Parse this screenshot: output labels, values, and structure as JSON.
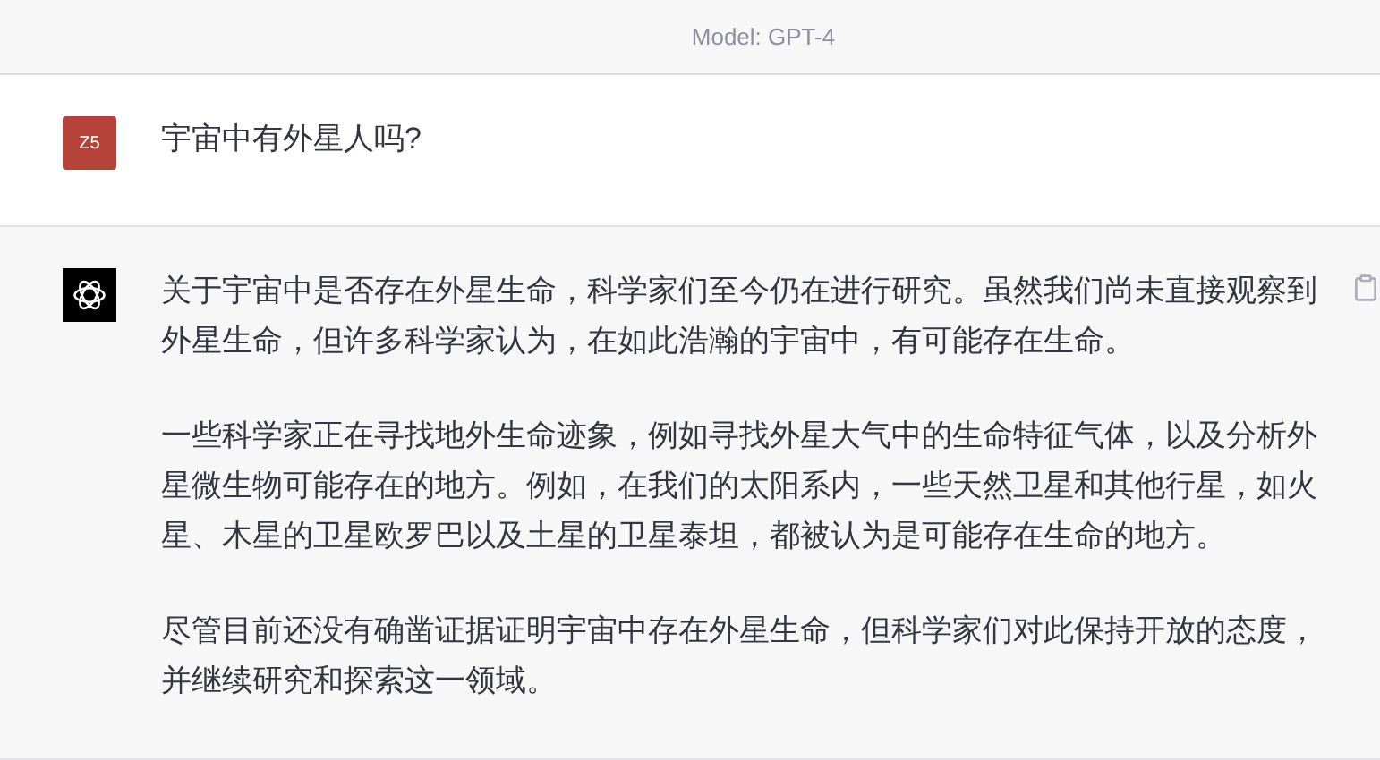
{
  "header": {
    "model": "Model: GPT-4"
  },
  "messages": [
    {
      "kind": "user",
      "avatar": "Z5",
      "paragraphs": [
        "宇宙中有外星人吗?"
      ]
    },
    {
      "kind": "assistant",
      "paragraphs": [
        "关于宇宙中是否存在外星生命，科学家们至今仍在进行研究。虽然我们尚未直接观察到外星生命，但许多科学家认为，在如此浩瀚的宇宙中，有可能存在生命。",
        "一些科学家正在寻找地外生命迹象，例如寻找外星大气中的生命特征气体，以及分析外星微生物可能存在的地方。例如，在我们的太阳系内，一些天然卫星和其他行星，如火星、木星的卫星欧罗巴以及土星的卫星泰坦，都被认为是可能存在生命的地方。",
        "尽管目前还没有确凿证据证明宇宙中存在外星生命，但科学家们对此保持开放的态度，并继续研究和探索这一领域。"
      ]
    }
  ]
}
